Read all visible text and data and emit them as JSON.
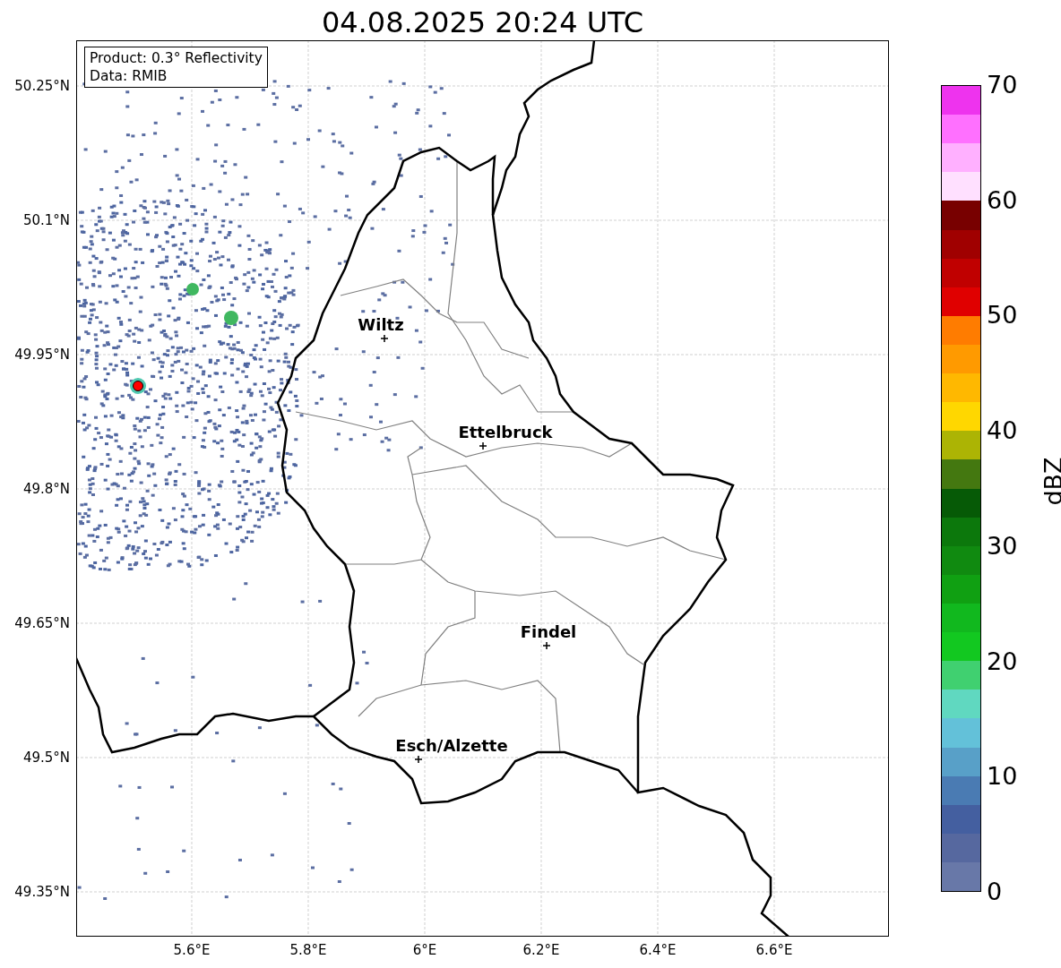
{
  "title": "04.08.2025 20:24 UTC",
  "info": [
    "Product: 0.3° Reflectivity",
    "Data: RMIB"
  ],
  "lat_ticks": [
    "50.25°N",
    "50.1°N",
    "49.95°N",
    "49.8°N",
    "49.65°N",
    "49.5°N",
    "49.35°N"
  ],
  "lon_ticks": [
    "5.6°E",
    "5.8°E",
    "6°E",
    "6.2°E",
    "6.4°E",
    "6.6°E"
  ],
  "cities": [
    {
      "name": "Wiltz"
    },
    {
      "name": "Ettelbruck"
    },
    {
      "name": "Findel"
    },
    {
      "name": "Esch/Alzette"
    }
  ],
  "colorbar": {
    "label": "dBZ",
    "ticks": [
      "70",
      "60",
      "50",
      "40",
      "30",
      "20",
      "10",
      "0"
    ],
    "bins": [
      {
        "color": "#ee33ee"
      },
      {
        "color": "#ff70ff"
      },
      {
        "color": "#ffb0ff"
      },
      {
        "color": "#ffe0ff"
      },
      {
        "color": "#780000"
      },
      {
        "color": "#a00000"
      },
      {
        "color": "#c00000"
      },
      {
        "color": "#e00000"
      },
      {
        "color": "#ff7c00"
      },
      {
        "color": "#ff9a00"
      },
      {
        "color": "#ffb800"
      },
      {
        "color": "#ffd700"
      },
      {
        "color": "#acb404"
      },
      {
        "color": "#447810"
      },
      {
        "color": "#065a06"
      },
      {
        "color": "#0c780c"
      },
      {
        "color": "#108a10"
      },
      {
        "color": "#10a012"
      },
      {
        "color": "#11b81e"
      },
      {
        "color": "#12c820"
      },
      {
        "color": "#40d070"
      },
      {
        "color": "#60d8c0"
      },
      {
        "color": "#63c1d9"
      },
      {
        "color": "#58a0c8"
      },
      {
        "color": "#4a7bb3"
      },
      {
        "color": "#445fa0"
      },
      {
        "color": "#56689f"
      },
      {
        "color": "#6878a8"
      }
    ]
  }
}
